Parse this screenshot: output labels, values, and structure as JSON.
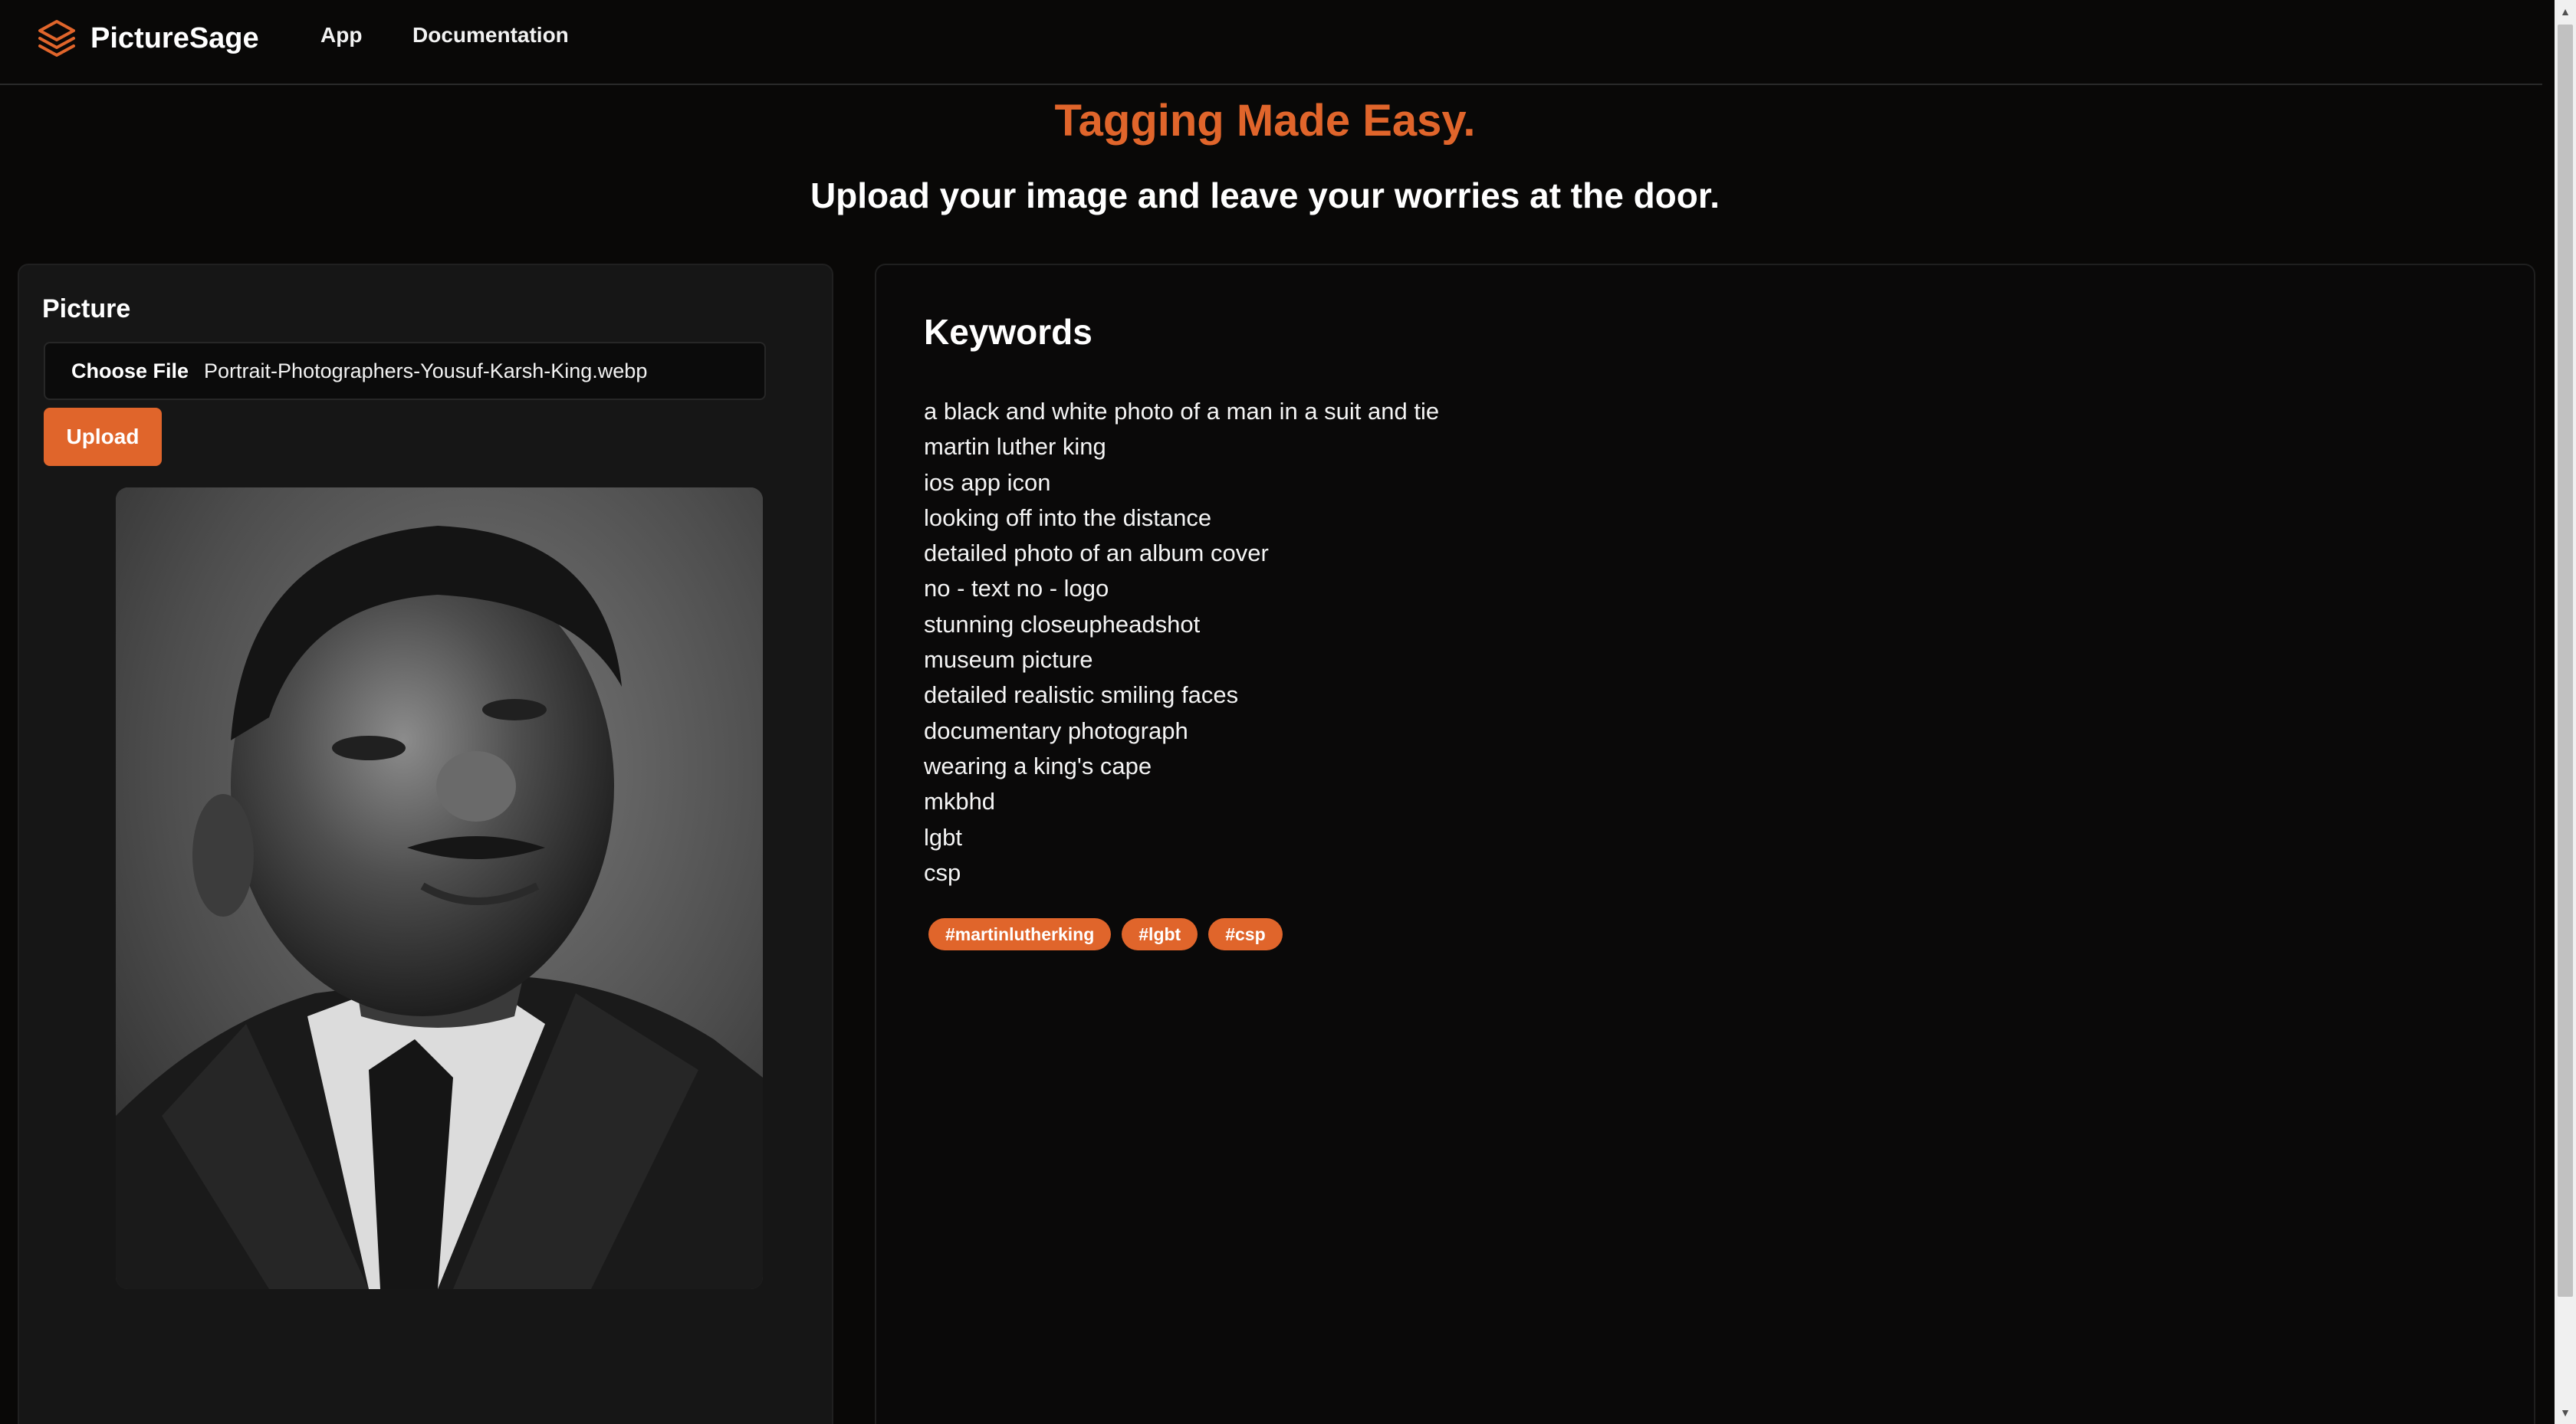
{
  "nav": {
    "brand": "PictureSage",
    "links": [
      "App",
      "Documentation"
    ]
  },
  "hero": {
    "title": "Tagging Made Easy.",
    "subtitle": "Upload your image and leave your worries at the door."
  },
  "picture_panel": {
    "label": "Picture",
    "choose_file_label": "Choose File",
    "file_name": "Portrait-Photographers-Yousuf-Karsh-King.webp",
    "upload_label": "Upload"
  },
  "keywords_panel": {
    "heading": "Keywords",
    "keywords": [
      "a black and white photo of a man in a suit and tie",
      "martin luther king",
      "ios app icon",
      "looking off into the distance",
      "detailed photo of an album cover",
      "no - text no - logo",
      "stunning closeupheadshot",
      "museum picture",
      "detailed realistic smiling faces",
      "documentary photograph",
      "wearing a king's cape",
      "mkbhd",
      "lgbt",
      "csp"
    ],
    "hashtags": [
      "#martinlutherking",
      "#lgbt",
      "#csp"
    ]
  },
  "colors": {
    "accent": "#e0652b",
    "background": "#090807",
    "panel": "#161616"
  },
  "icons": {
    "brand": "layers-stack-icon"
  }
}
